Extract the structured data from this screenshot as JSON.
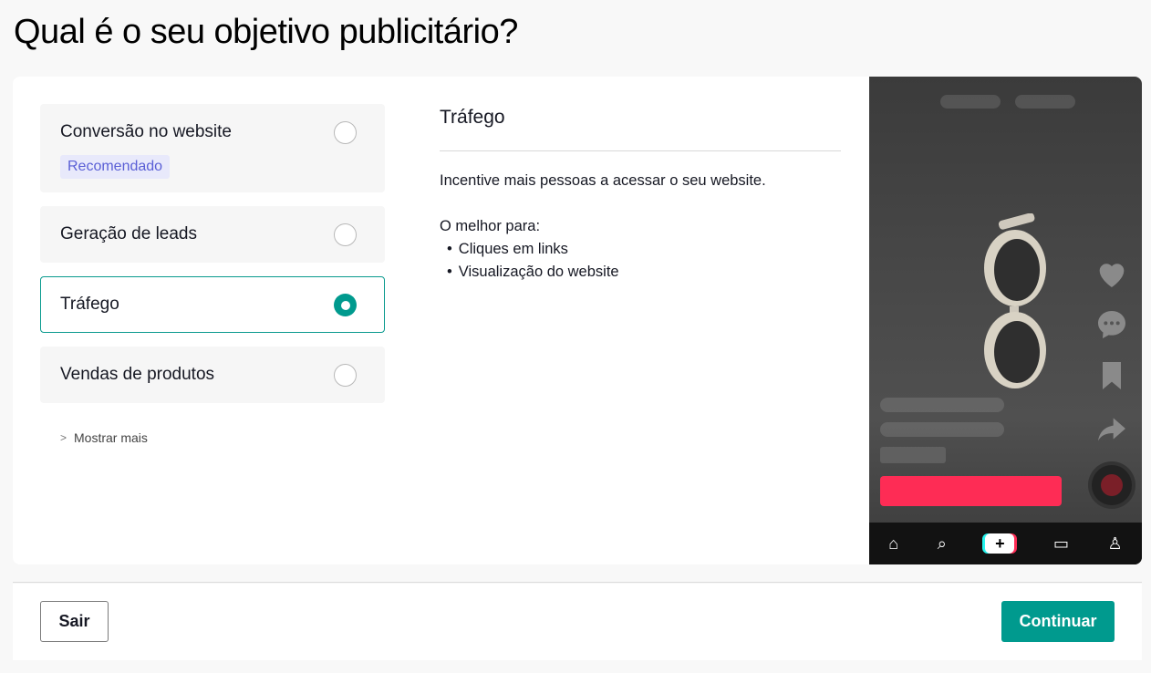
{
  "page": {
    "title": "Qual é o seu objetivo publicitário?"
  },
  "objectives": [
    {
      "label": "Conversão no website",
      "badge": "Recomendado",
      "selected": false
    },
    {
      "label": "Geração de leads",
      "selected": false
    },
    {
      "label": "Tráfego",
      "selected": true
    },
    {
      "label": "Vendas de produtos",
      "selected": false
    }
  ],
  "show_more": {
    "label": "Mostrar mais",
    "icon": "chevron-right-icon"
  },
  "detail": {
    "title": "Tráfego",
    "description": "Incentive mais pessoas a acessar o seu website.",
    "best_for_label": "O melhor para:",
    "best_for": [
      "Cliques em links",
      "Visualização do website"
    ]
  },
  "preview": {
    "cta_color": "#fe2c55",
    "nav_icons": [
      "home-icon",
      "search-icon",
      "plus-icon",
      "inbox-icon",
      "profile-icon"
    ],
    "side_icons": [
      "heart-icon",
      "comment-icon",
      "bookmark-icon",
      "share-icon"
    ]
  },
  "footer": {
    "exit_label": "Sair",
    "continue_label": "Continuar"
  },
  "colors": {
    "accent": "#009a8e",
    "badge_text": "#5a5fd6",
    "badge_bg": "#e8e9fb"
  }
}
